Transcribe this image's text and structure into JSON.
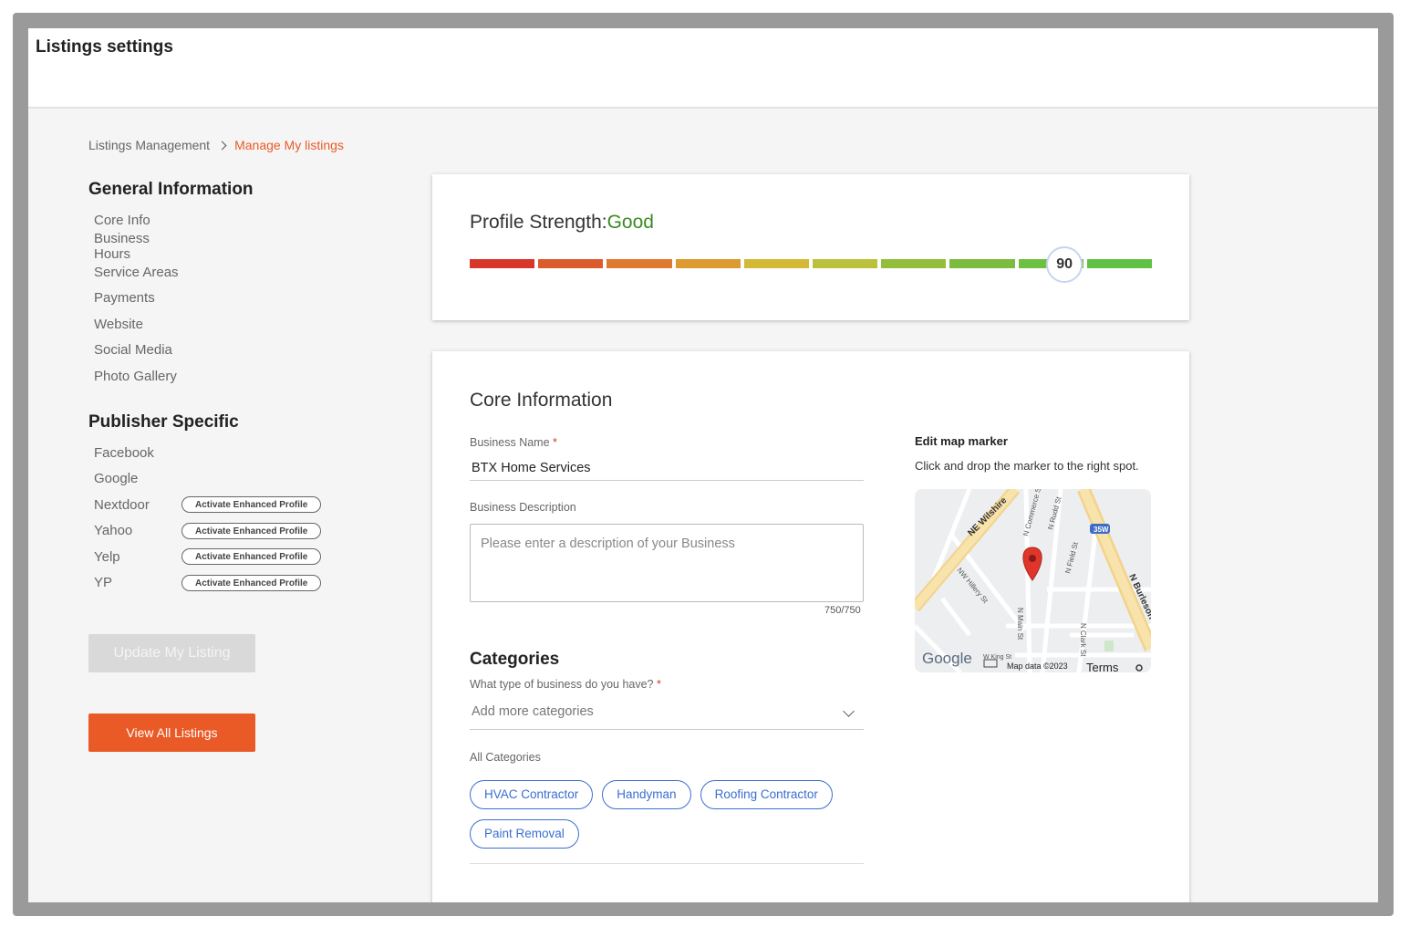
{
  "header": {
    "title": "Listings settings"
  },
  "breadcrumb": {
    "parent": "Listings Management",
    "current": "Manage My listings"
  },
  "sidebar": {
    "general_heading": "General Information",
    "general_items": [
      "Core Info",
      "Business Hours",
      "Service Areas",
      "Payments",
      "Website",
      "Social Media",
      "Photo Gallery"
    ],
    "publisher_heading": "Publisher Specific",
    "publisher_items": [
      "Facebook",
      "Google",
      "Nextdoor",
      "Yahoo",
      "Yelp",
      "YP"
    ],
    "enhanced_label": "Activate Enhanced Profile",
    "update_button": "Update My Listing",
    "view_all_button": "View All Listings"
  },
  "profile_strength": {
    "label": "Profile Strength:",
    "status": "Good",
    "score": "90",
    "score_fraction": 0.9,
    "segment_colors": [
      "#d9362b",
      "#dc5b2c",
      "#de7a2f",
      "#dc9a30",
      "#d3b936",
      "#b9c23a",
      "#93be3c",
      "#7bbc3f",
      "#6cc143",
      "#5fc244"
    ]
  },
  "core_info": {
    "title": "Core Information",
    "business_name_label": "Business Name",
    "business_name_value": "BTX Home Services",
    "description_label": "Business Description",
    "description_placeholder": "Please enter a description of your Business",
    "char_counter": "750/750",
    "categories_title": "Categories",
    "categories_question": "What type of business do you have?",
    "categories_placeholder": "Add more categories",
    "all_categories_label": "All Categories",
    "categories": [
      "HVAC Contractor",
      "Handyman",
      "Roofing Contractor",
      "Paint Removal"
    ],
    "required_mark": "*"
  },
  "map": {
    "heading": "Edit map marker",
    "instruction": "Click and drop the marker to the right spot.",
    "streets": [
      "NE Wilshire",
      "N Commerce St",
      "N Rudd St",
      "N Field St",
      "NW Hillery St",
      "N Main St",
      "N Clark St",
      "N Burleson",
      "W King St"
    ],
    "shield": "35W",
    "google": "Google",
    "map_data": "Map data ©2023",
    "terms": "Terms"
  },
  "colors": {
    "accent": "#ea5a27",
    "good": "#3a8a22",
    "chip": "#3a6fd0"
  }
}
